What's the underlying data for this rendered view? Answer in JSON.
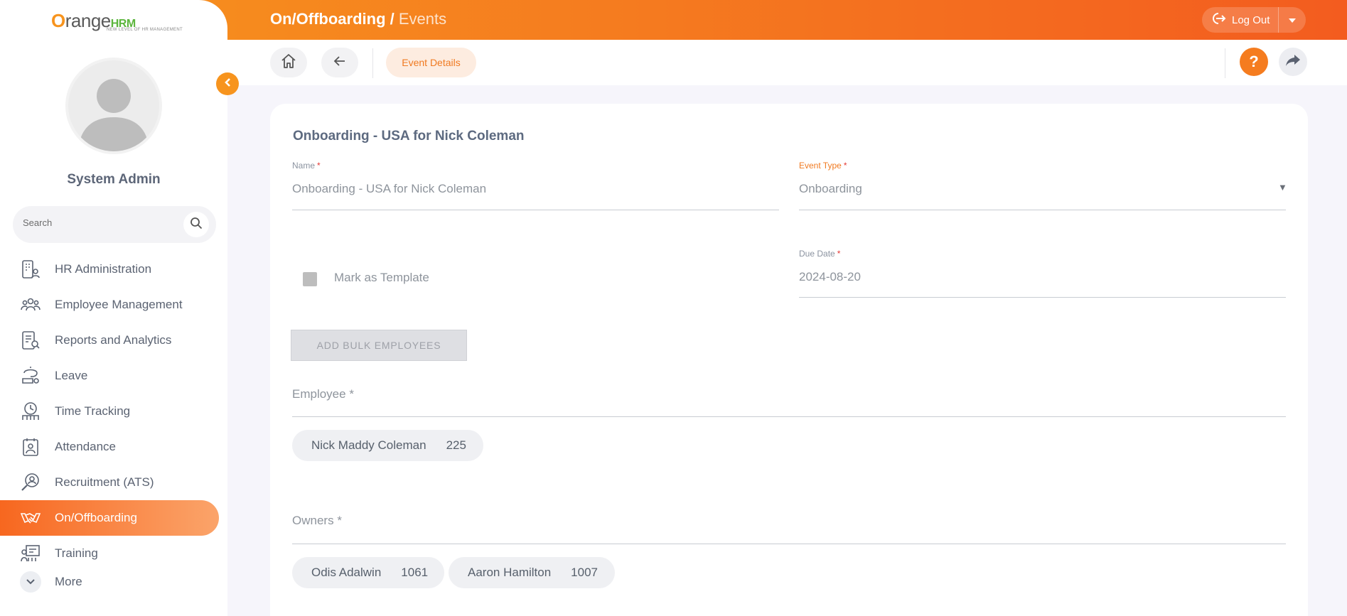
{
  "header": {
    "module": "On/Offboarding",
    "separator": " / ",
    "page": "Events",
    "logout_label": "Log Out"
  },
  "logo": {
    "brand_main": "range",
    "brand_o": "O",
    "brand_suffix": "HRM",
    "tagline": "NEW LEVEL OF HR MANAGEMENT"
  },
  "sidebar": {
    "user_name": "System Admin",
    "search_placeholder": "Search",
    "items": [
      {
        "label": "HR Administration",
        "icon": "hr-admin-icon"
      },
      {
        "label": "Employee Management",
        "icon": "employees-icon"
      },
      {
        "label": "Reports and Analytics",
        "icon": "reports-icon"
      },
      {
        "label": "Leave",
        "icon": "leave-icon"
      },
      {
        "label": "Time Tracking",
        "icon": "time-icon"
      },
      {
        "label": "Attendance",
        "icon": "attendance-icon"
      },
      {
        "label": "Recruitment (ATS)",
        "icon": "recruitment-icon"
      },
      {
        "label": "On/Offboarding",
        "icon": "handshake-icon",
        "active": true
      },
      {
        "label": "Training",
        "icon": "training-icon"
      }
    ],
    "more_label": "More"
  },
  "toolbar": {
    "active_tab": "Event Details",
    "help": "?"
  },
  "form": {
    "title": "Onboarding - USA for Nick Coleman",
    "name_label": "Name",
    "name_value": "Onboarding - USA for Nick Coleman",
    "event_type_label": "Event Type",
    "event_type_value": "Onboarding",
    "mark_template_label": "Mark as Template",
    "due_date_label": "Due Date",
    "due_date_value": "2024-08-20",
    "bulk_button": "ADD BULK EMPLOYEES",
    "employee_label": "Employee",
    "owners_label": "Owners",
    "required_mark": "*",
    "employees": [
      {
        "name": "Nick Maddy Coleman",
        "id": "225"
      }
    ],
    "owners": [
      {
        "name": "Odis Adalwin",
        "id": "1061"
      },
      {
        "name": "Aaron Hamilton",
        "id": "1007"
      }
    ]
  },
  "colors": {
    "accent": "#f57c1f",
    "active_menu": "#f7671f",
    "background": "#f6f5fb"
  }
}
